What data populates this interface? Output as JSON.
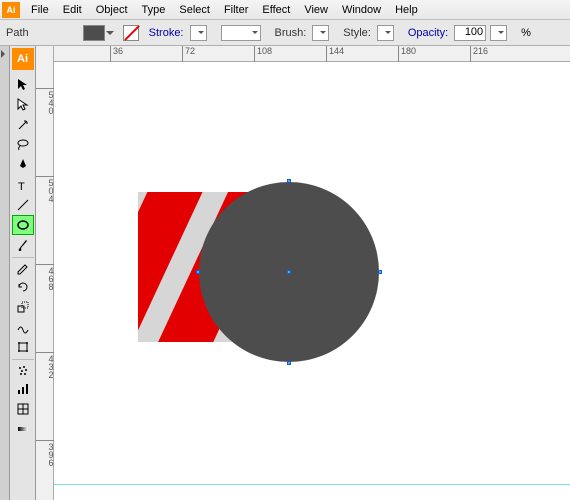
{
  "menu": {
    "items": [
      "File",
      "Edit",
      "Object",
      "Type",
      "Select",
      "Filter",
      "Effect",
      "View",
      "Window",
      "Help"
    ]
  },
  "controlbar": {
    "selection": "Path",
    "stroke_label": "Stroke:",
    "stroke_value": "",
    "brush_label": "Brush:",
    "style_label": "Style:",
    "opacity_label": "Opacity:",
    "opacity_value": "100",
    "opacity_unit": "%",
    "fill_color": "#4d4d4d"
  },
  "app_badge": "Ai",
  "tools": [
    {
      "name": "selection-tool",
      "glyph": "arrow"
    },
    {
      "name": "direct-selection-tool",
      "glyph": "arrow-white"
    },
    {
      "name": "magic-wand-tool",
      "glyph": "wand"
    },
    {
      "name": "lasso-tool",
      "glyph": "lasso"
    },
    {
      "name": "pen-tool",
      "glyph": "pen"
    },
    {
      "name": "type-tool",
      "glyph": "T"
    },
    {
      "name": "line-tool",
      "glyph": "line"
    },
    {
      "name": "ellipse-tool",
      "glyph": "ellipse",
      "selected": true
    },
    {
      "name": "brush-tool",
      "glyph": "brush"
    },
    {
      "name": "pencil-tool",
      "glyph": "pencil"
    },
    {
      "name": "rotate-tool",
      "glyph": "rotate"
    },
    {
      "name": "scale-tool",
      "glyph": "scale"
    },
    {
      "name": "warp-tool",
      "glyph": "warp"
    },
    {
      "name": "free-transform-tool",
      "glyph": "free"
    },
    {
      "name": "symbol-sprayer-tool",
      "glyph": "spray"
    },
    {
      "name": "graph-tool",
      "glyph": "graph"
    },
    {
      "name": "mesh-tool",
      "glyph": "mesh"
    },
    {
      "name": "gradient-tool",
      "glyph": "gradient"
    }
  ],
  "h_ruler": [
    {
      "pos": 56,
      "label": "36"
    },
    {
      "pos": 128,
      "label": "72"
    },
    {
      "pos": 200,
      "label": "108"
    },
    {
      "pos": 272,
      "label": "144"
    },
    {
      "pos": 344,
      "label": "180"
    },
    {
      "pos": 416,
      "label": "216"
    }
  ],
  "v_ruler": [
    {
      "pos": 42,
      "label": "540"
    },
    {
      "pos": 130,
      "label": "504"
    },
    {
      "pos": 218,
      "label": "468"
    },
    {
      "pos": 306,
      "label": "432"
    },
    {
      "pos": 394,
      "label": "396"
    }
  ]
}
